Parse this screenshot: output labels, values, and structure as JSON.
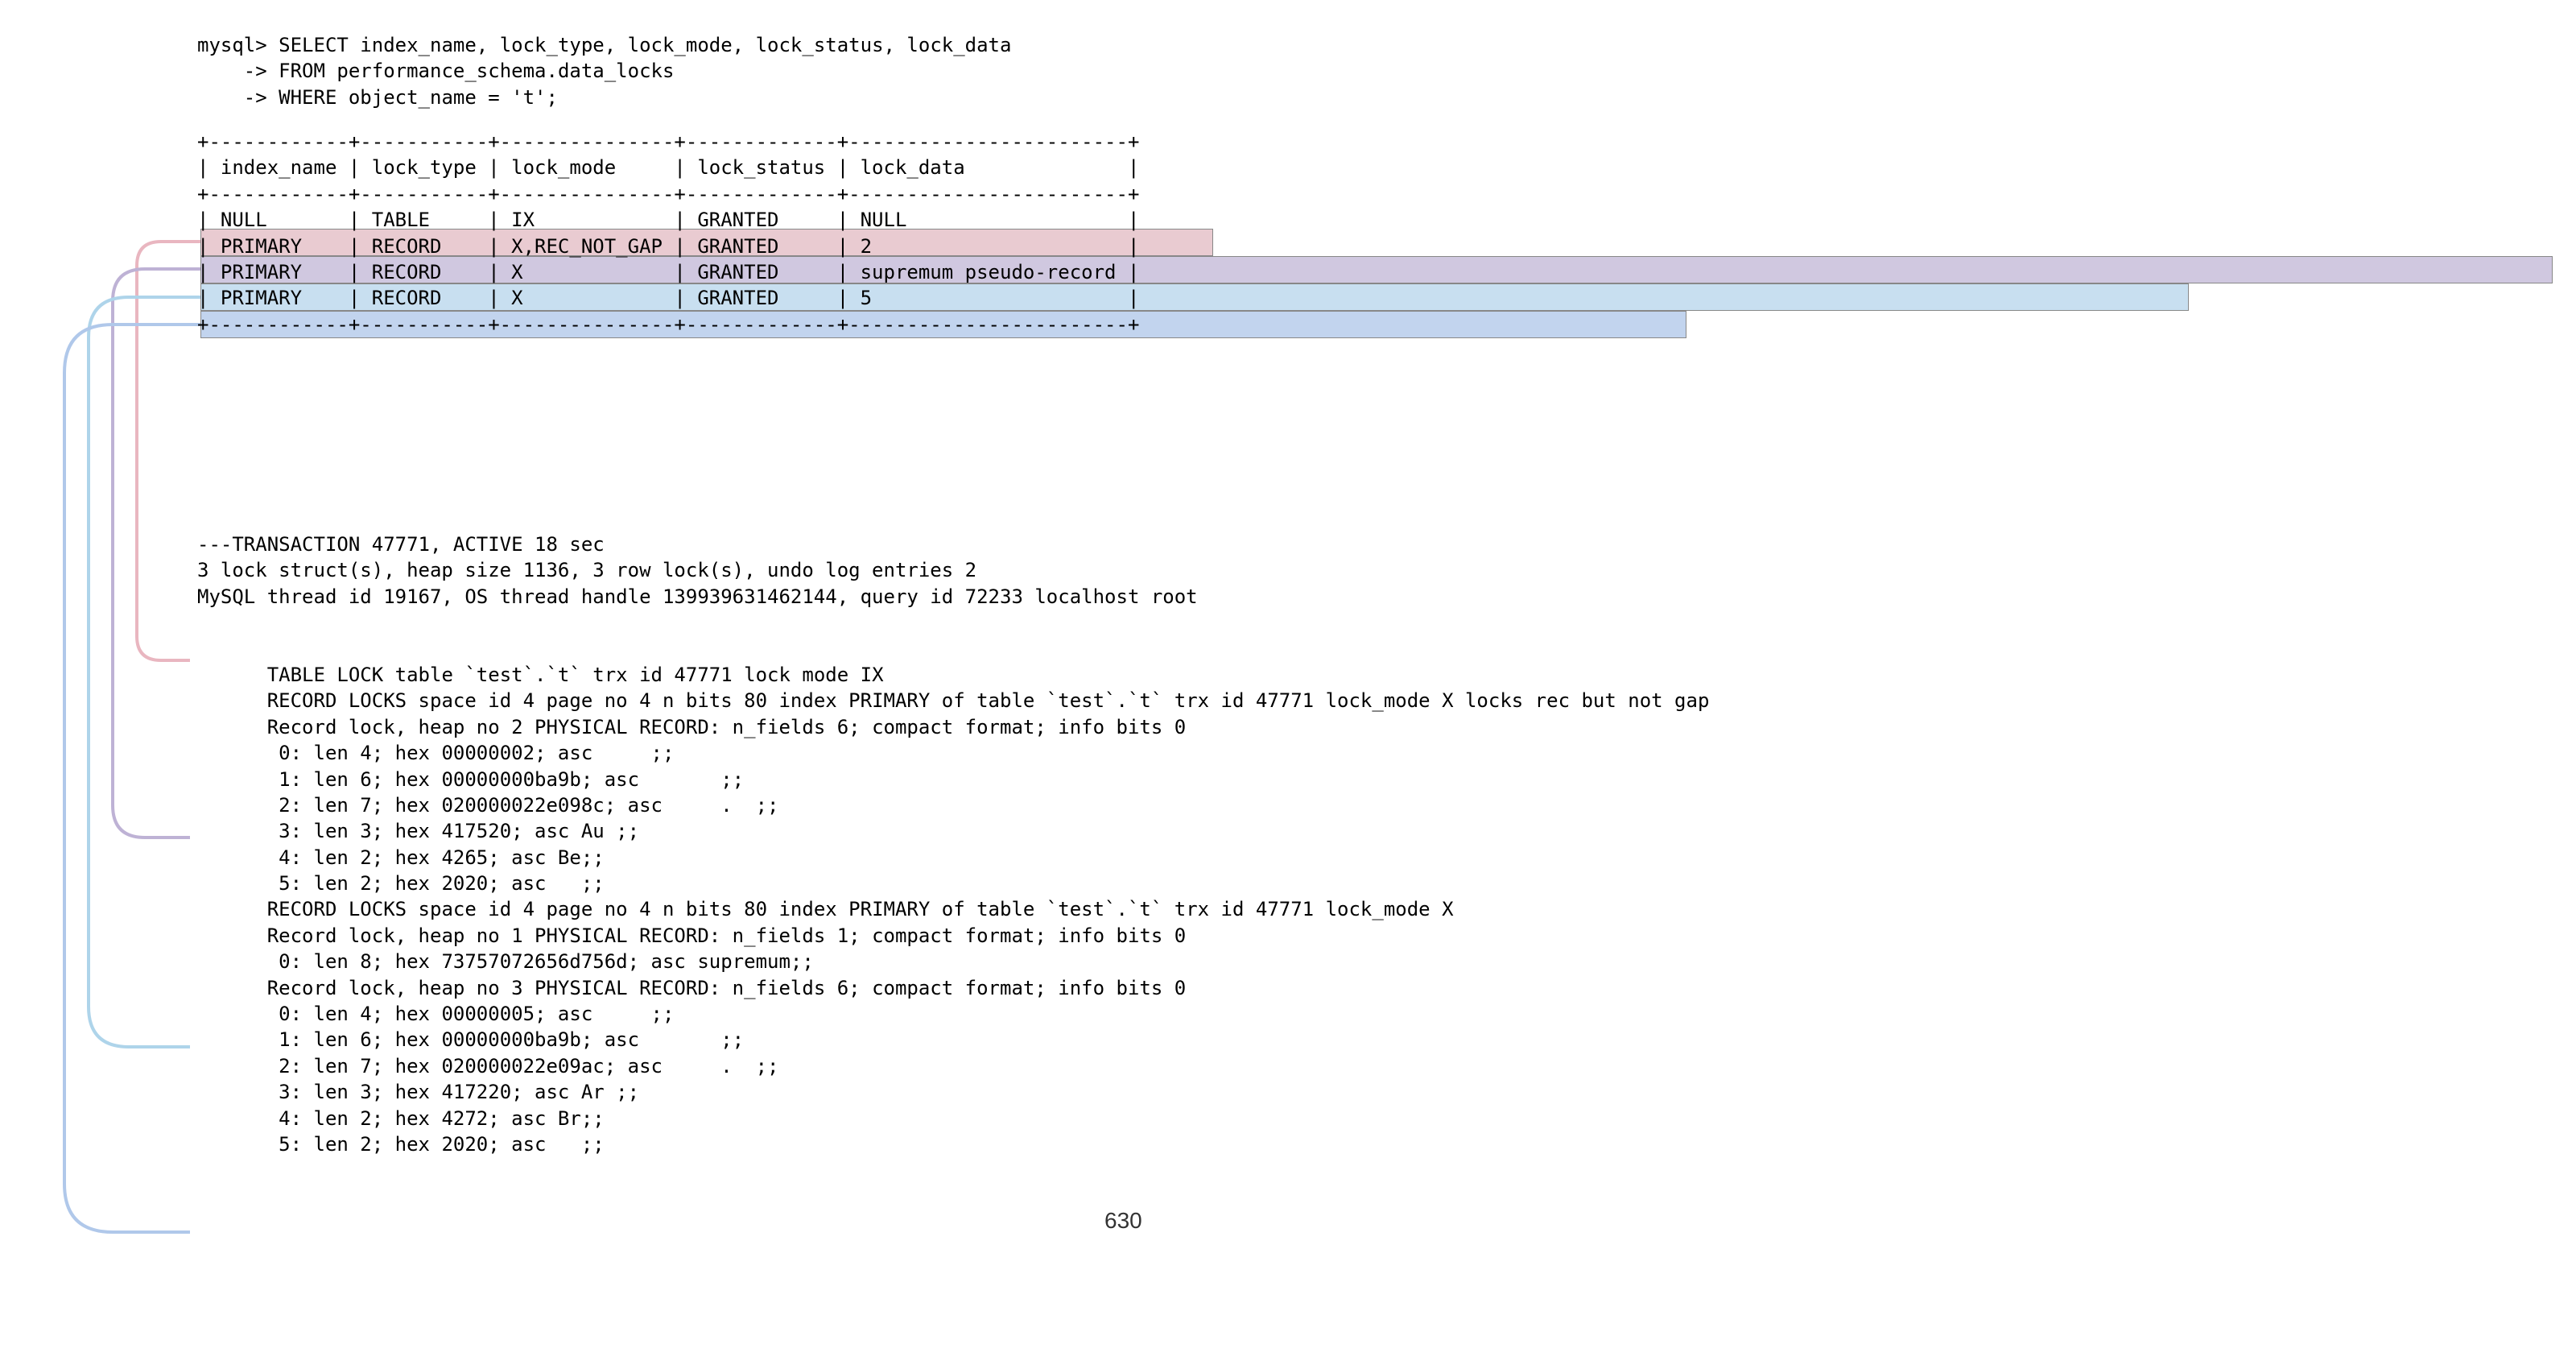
{
  "sql": {
    "prompt": "mysql>",
    "cont": "    ->",
    "line1": "SELECT index_name, lock_type, lock_mode, lock_status, lock_data",
    "line2": "FROM performance_schema.data_locks",
    "line3": "WHERE object_name = 't';"
  },
  "table": {
    "border_top": "+------------+-----------+---------------+-------------+------------------------+",
    "header": "| index_name | lock_type | lock_mode     | lock_status | lock_data              |",
    "border_mid": "+------------+-----------+---------------+-------------+------------------------+",
    "row1": "| NULL       | TABLE     | IX            | GRANTED     | NULL                   |",
    "row2": "| PRIMARY    | RECORD    | X,REC_NOT_GAP | GRANTED     | 2                      |",
    "row3": "| PRIMARY    | RECORD    | X             | GRANTED     | supremum pseudo-record |",
    "row4": "| PRIMARY    | RECORD    | X             | GRANTED     | 5                      |",
    "border_bot": "+------------+-----------+---------------+-------------+------------------------+"
  },
  "colors": {
    "pink": "#e9cbd1",
    "purple": "#d0c8e0",
    "lblue": "#c8dff0",
    "blue": "#c2d4ee"
  },
  "status": {
    "l1": "---TRANSACTION 47771, ACTIVE 18 sec",
    "l2": "3 lock struct(s), heap size 1136, 3 row lock(s), undo log entries 2",
    "l3": "MySQL thread id 19167, OS thread handle 139939631462144, query id 72233 localhost root",
    "pink1": "TABLE LOCK table `test`.`t` trx id 47771 lock mode IX",
    "pur1": "RECORD LOCKS space id 4 page no 4 n bits 80 index PRIMARY of table `test`.`t` trx id 47771 lock_mode X locks rec but not gap",
    "pur2": "Record lock, heap no 2 PHYSICAL RECORD: n_fields 6; compact format; info bits 0",
    "pur3": " 0: len 4; hex 00000002; asc     ;;",
    "pur4": " 1: len 6; hex 00000000ba9b; asc       ;;",
    "pur5": " 2: len 7; hex 020000022e098c; asc     .  ;;",
    "pur6": " 3: len 3; hex 417520; asc Au ;;",
    "pur7": " 4: len 2; hex 4265; asc Be;;",
    "pur8": " 5: len 2; hex 2020; asc   ;;",
    "lb1": "RECORD LOCKS space id 4 page no 4 n bits 80 index PRIMARY of table `test`.`t` trx id 47771 lock_mode X",
    "lb2": "Record lock, heap no 1 PHYSICAL RECORD: n_fields 1; compact format; info bits 0",
    "lb3": " 0: len 8; hex 73757072656d756d; asc supremum;;",
    "bl1": "Record lock, heap no 3 PHYSICAL RECORD: n_fields 6; compact format; info bits 0",
    "bl2": " 0: len 4; hex 00000005; asc     ;;",
    "bl3": " 1: len 6; hex 00000000ba9b; asc       ;;",
    "bl4": " 2: len 7; hex 020000022e09ac; asc     .  ;;",
    "bl5": " 3: len 3; hex 417220; asc Ar ;;",
    "bl6": " 4: len 2; hex 4272; asc Br;;",
    "bl7": " 5: len 2; hex 2020; asc   ;;"
  },
  "page_number": "630"
}
